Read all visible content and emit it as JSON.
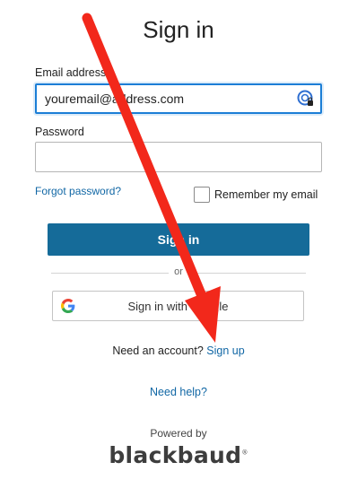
{
  "page": {
    "title": "Sign in"
  },
  "form": {
    "email_label": "Email address",
    "email_value": "youremail@address.com",
    "password_label": "Password",
    "password_value": "",
    "forgot_password": "Forgot password?",
    "remember_label": "Remember my email",
    "remember_checked": false,
    "signin_button": "Sign in",
    "or_text": "or",
    "google_button": "Sign in with Google",
    "password_manager_icon": "password-manager-key-icon",
    "google_icon": "google-g-icon"
  },
  "footer": {
    "need_account": "Need an account?",
    "signup_link": "Sign up",
    "need_help": "Need help?",
    "powered_by": "Powered by",
    "brand": "blackbaud",
    "trademark": "®"
  },
  "annotation": {
    "arrow_color": "#f2281b"
  },
  "colors": {
    "primary": "#156b99",
    "link": "#1167a5",
    "focus": "#1c7ed6"
  }
}
